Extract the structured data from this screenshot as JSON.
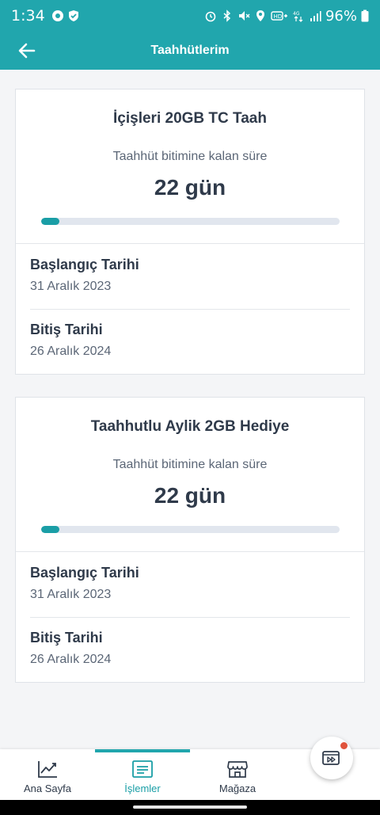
{
  "status_bar": {
    "time": "1:34",
    "battery": "96%",
    "left_icons": [
      "app-notification-icon",
      "shield-check-icon"
    ],
    "right_icons": [
      "alarm-icon",
      "bluetooth-icon",
      "mute-icon",
      "location-icon",
      "hd-voice-icon",
      "4g-data-icon",
      "signal-icon",
      "battery-icon"
    ]
  },
  "header": {
    "title": "Taahhütlerim",
    "back_icon": "arrow-left-icon"
  },
  "commitments": [
    {
      "title": "İçişleri 20GB TC Taah",
      "remaining_label": "Taahhüt bitimine kalan süre",
      "remaining_value": "22 gün",
      "progress_percent": 6,
      "start_label": "Başlangıç Tarihi",
      "start_date": "31 Aralık 2023",
      "end_label": "Bitiş Tarihi",
      "end_date": "26 Aralık 2024"
    },
    {
      "title": "Taahhutlu Aylik 2GB Hediye",
      "remaining_label": "Taahhüt bitimine kalan süre",
      "remaining_value": "22 gün",
      "progress_percent": 6,
      "start_label": "Başlangıç Tarihi",
      "start_date": "31 Aralık 2023",
      "end_label": "Bitiş Tarihi",
      "end_date": "26 Aralık 2024"
    }
  ],
  "bottom_nav": {
    "items": [
      {
        "label": "Ana Sayfa",
        "icon": "chart-line-icon",
        "active": false
      },
      {
        "label": "İşlemler",
        "icon": "list-card-icon",
        "active": true
      },
      {
        "label": "Mağaza",
        "icon": "store-icon",
        "active": false
      }
    ],
    "fab_icon": "fast-forward-icon"
  },
  "colors": {
    "primary": "#21a6ad",
    "progress": "#1a9ea6",
    "text": "#2f3a4a",
    "muted": "#5b6676",
    "badge": "#e0533c"
  }
}
